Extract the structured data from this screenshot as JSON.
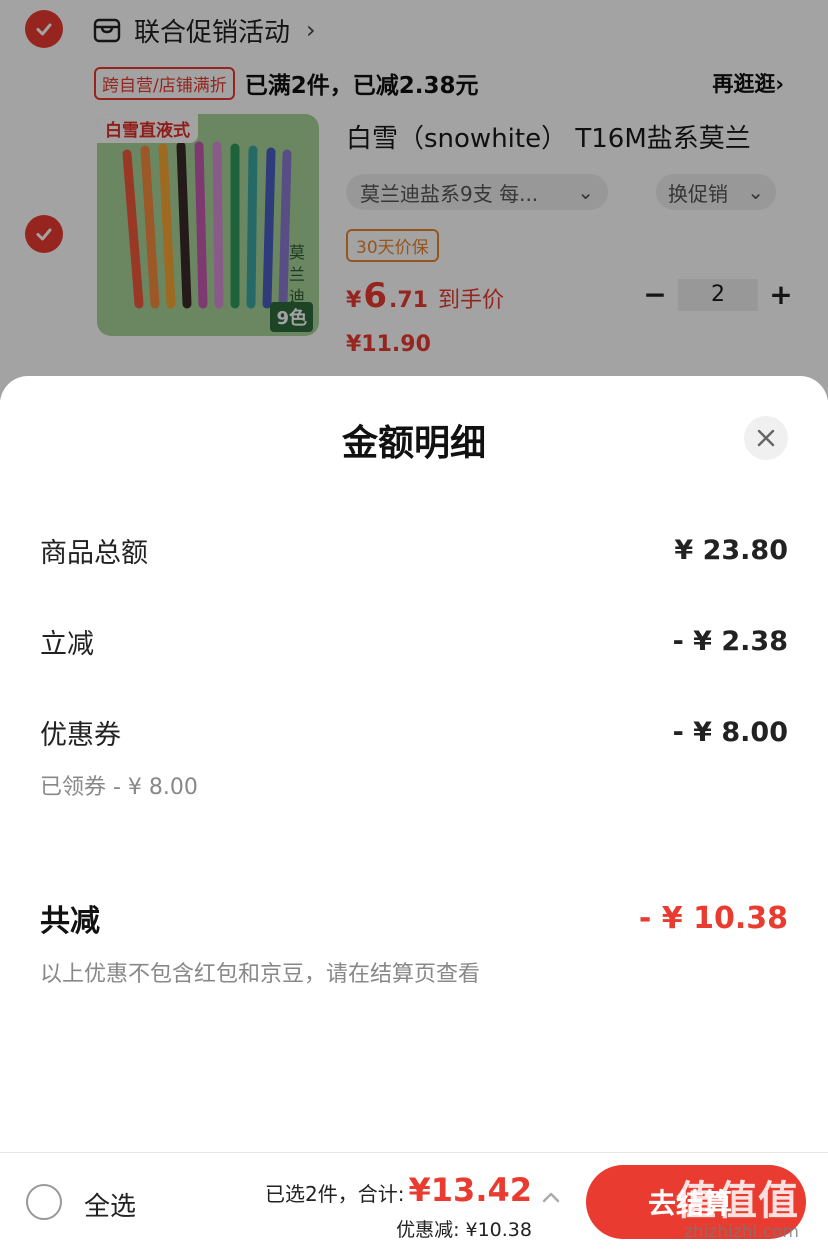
{
  "cart": {
    "store": {
      "title": "联合促销活动",
      "chevron": "›",
      "icon": "store-icon"
    },
    "promo": {
      "tag": "跨自营/店铺满折",
      "text": "已满2件，已减2.38元",
      "more": "再逛逛›"
    },
    "product": {
      "image_label": "白雪直液式",
      "image_side_text": "莫兰迪",
      "image_count": "9色",
      "title": "白雪（snowhite） T16M盐系莫兰",
      "spec": "莫兰迪盐系9支 每...",
      "promo_switch": "换促销",
      "guarantee": "30天价保",
      "price_symbol": "¥",
      "price_int": "6",
      "price_dec": ".71",
      "price_label": "到手价",
      "original_price": "¥11.90",
      "quantity": "2",
      "minus": "−",
      "plus": "+"
    }
  },
  "sheet": {
    "title": "金额明细",
    "rows": [
      {
        "label": "商品总额",
        "value": "¥ 23.80"
      },
      {
        "label": "立减",
        "value": "- ¥ 2.38"
      },
      {
        "label": "优惠券",
        "value": "- ¥ 8.00"
      }
    ],
    "coupon_note": "已领券 - ¥ 8.00",
    "total": {
      "label": "共减",
      "value": "- ¥ 10.38"
    },
    "disclaimer": "以上优惠不包含红包和京豆，请在结算页查看"
  },
  "bottom_bar": {
    "select_all": "全选",
    "selected_text": "已选2件，合计:",
    "total_price": "¥13.42",
    "discount_text": "优惠减: ¥10.38",
    "checkout_label": "去结算"
  },
  "watermark": {
    "text": "值值值",
    "url": "zhizhizhi.com"
  },
  "colors": {
    "accent": "#e93b2f",
    "guarantee": "#e9872f",
    "thumb_bg": "#a6d39a"
  }
}
